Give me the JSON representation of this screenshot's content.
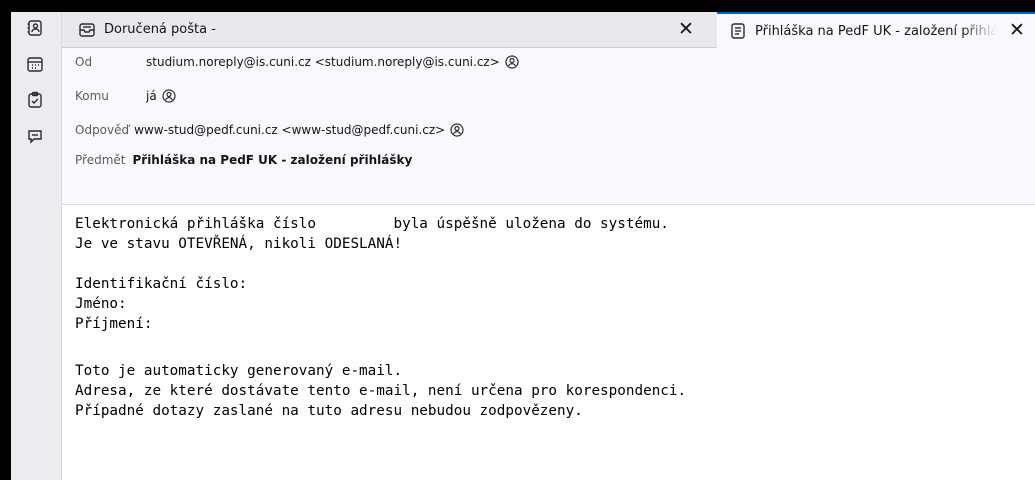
{
  "sidebar": {
    "items": [
      {
        "icon": "address-book-icon"
      },
      {
        "icon": "calendar-icon"
      },
      {
        "icon": "tasks-icon"
      },
      {
        "icon": "chat-icon"
      }
    ]
  },
  "tabs": [
    {
      "label": "Doručená pošta -",
      "icon": "inbox-icon",
      "close": "✕"
    },
    {
      "label": "Přihláška na PedF UK - založení přihlášky",
      "icon": "message-icon",
      "close": "✕"
    }
  ],
  "header": {
    "from_label": "Od",
    "from_value": "studium.noreply@is.cuni.cz <studium.noreply@is.cuni.cz>",
    "to_label": "Komu",
    "to_value": "já",
    "reply_label": "Odpověď",
    "reply_value": "www-stud@pedf.cuni.cz <www-stud@pedf.cuni.cz>",
    "subject_label": "Předmět",
    "subject_value": "Přihláška na PedF UK - založení přihlášky"
  },
  "body": {
    "lines": [
      "Elektronická přihláška číslo         byla úspěšně uložena do systému.",
      "Je ve stavu OTEVŘENÁ, nikoli ODESLANÁ!",
      "",
      "Identifikační číslo:",
      "Jméno:",
      "Příjmení:",
      "",
      "Toto je automaticky generovaný e-mail.",
      "Adresa, ze které dostávate tento e-mail, není určena pro korespondenci.",
      "Případné dotazy zaslané na tuto adresu nebudou zodpovězeny."
    ]
  }
}
